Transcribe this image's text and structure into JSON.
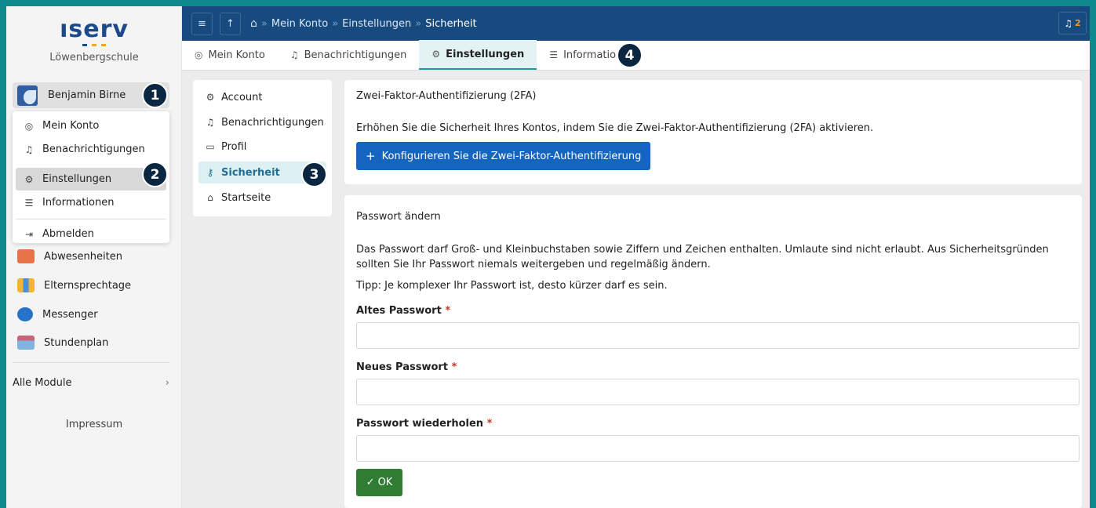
{
  "brand": {
    "logo": "ıserv",
    "school": "Löwenbergschule"
  },
  "user": {
    "name": "Benjamin Birne"
  },
  "user_menu": [
    {
      "label": "Mein Konto",
      "icon": "account-circle-icon"
    },
    {
      "label": "Benachrichtigungen",
      "icon": "bell-icon"
    },
    {
      "label": "Einstellungen",
      "icon": "gear-icon",
      "active": true
    },
    {
      "label": "Informationen",
      "icon": "list-icon"
    },
    {
      "label": "Abmelden",
      "icon": "logout-icon"
    }
  ],
  "modules": [
    {
      "label": "Abwesenheiten",
      "icon": "absence-icon"
    },
    {
      "label": "Elternsprechtage",
      "icon": "people-icon"
    },
    {
      "label": "Messenger",
      "icon": "chat-bubble-icon"
    },
    {
      "label": "Stundenplan",
      "icon": "calendar-icon"
    }
  ],
  "all_modules": "Alle Module",
  "impressum": "Impressum",
  "topbar": {
    "breadcrumb": [
      "Mein Konto",
      "Einstellungen",
      "Sicherheit"
    ],
    "notification_count": "2"
  },
  "tabs": [
    {
      "label": "Mein Konto",
      "icon": "account-circle-icon"
    },
    {
      "label": "Benachrichtigungen",
      "icon": "bell-icon"
    },
    {
      "label": "Einstellungen",
      "icon": "gear-icon",
      "active": true
    },
    {
      "label": "Informationen",
      "icon": "list-icon"
    }
  ],
  "subnav": [
    {
      "label": "Account",
      "icon": "gear-icon"
    },
    {
      "label": "Benachrichtigungen",
      "icon": "bell-icon"
    },
    {
      "label": "Profil",
      "icon": "id-card-icon"
    },
    {
      "label": "Sicherheit",
      "icon": "key-icon",
      "active": true
    },
    {
      "label": "Startseite",
      "icon": "home-icon"
    }
  ],
  "twofa": {
    "title": "Zwei-Faktor-Authentifizierung (2FA)",
    "text": "Erhöhen Sie die Sicherheit Ihres Kontos, indem Sie die Zwei-Faktor-Authentifizierung (2FA) aktivieren.",
    "button": "Konfigurieren Sie die Zwei-Faktor-Authentifizierung"
  },
  "password": {
    "title": "Passwort ändern",
    "text": "Das Passwort darf Groß- und Kleinbuchstaben sowie Ziffern und Zeichen enthalten. Umlaute sind nicht erlaubt. Aus Sicherheitsgründen sollten Sie Ihr Passwort niemals weitergeben und regelmäßig ändern.",
    "tip": "Tipp: Je komplexer Ihr Passwort ist, desto kürzer darf es sein.",
    "old_label": "Altes Passwort",
    "new_label": "Neues Passwort",
    "repeat_label": "Passwort wiederholen",
    "required_mark": "*",
    "ok": "OK"
  },
  "callouts": [
    "1",
    "2",
    "3",
    "4"
  ],
  "colors": {
    "frame": "#0e8a8c",
    "topbar": "#174a7e",
    "primary": "#1565c0",
    "ok": "#2e7d32",
    "active_tab": "#e3f2f4",
    "callout": "#0b2640"
  }
}
